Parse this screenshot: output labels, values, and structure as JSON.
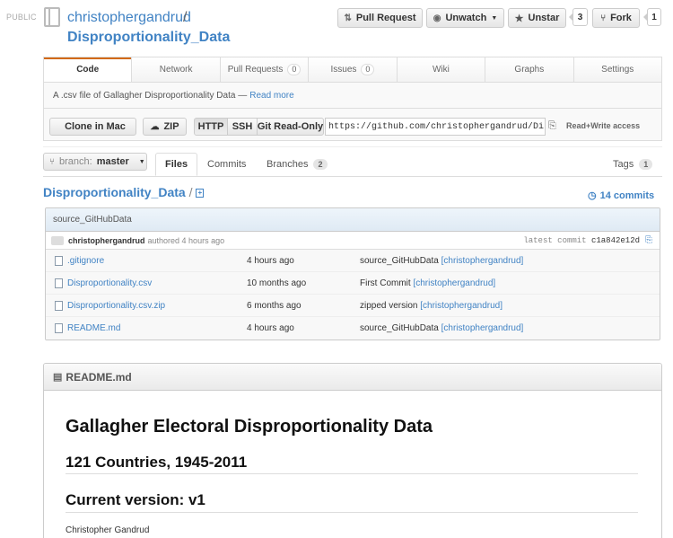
{
  "header": {
    "visibility": "PUBLIC",
    "owner": "christophergandrud",
    "separator": "/",
    "repo": "Disproportionality_Data",
    "buttons": {
      "pull_request": "Pull Request",
      "unwatch": "Unwatch",
      "unstar": "Unstar",
      "star_count": "3",
      "fork": "Fork",
      "fork_count": "1"
    }
  },
  "tabs": [
    {
      "label": "Code",
      "count": ""
    },
    {
      "label": "Network",
      "count": ""
    },
    {
      "label": "Pull Requests",
      "count": "0"
    },
    {
      "label": "Issues",
      "count": "0"
    },
    {
      "label": "Wiki",
      "count": ""
    },
    {
      "label": "Graphs",
      "count": ""
    },
    {
      "label": "Settings",
      "count": ""
    }
  ],
  "description": {
    "text": "A .csv file of Gallagher Disproportionality Data —",
    "link": "Read more"
  },
  "clone": {
    "clone_in_mac": "Clone in Mac",
    "zip": "ZIP",
    "http": "HTTP",
    "ssh": "SSH",
    "git_readonly": "Git Read-Only",
    "url": "https://github.com/christophergandrud/Di",
    "access": "Read+Write access"
  },
  "subnav": {
    "branch_prefix": "branch:",
    "branch": "master",
    "files": "Files",
    "commits": "Commits",
    "branches": "Branches",
    "branches_count": "2",
    "tags": "Tags",
    "tags_count": "1"
  },
  "breadcrumb": {
    "repo": "Disproportionality_Data",
    "sep": "/",
    "commits": "14 commits"
  },
  "latest": {
    "message": "source_GitHubData",
    "author": "christophergandrud",
    "authored": "authored 4 hours ago",
    "label": "latest commit",
    "sha": "c1a842e12d"
  },
  "files": [
    {
      "name": ".gitignore",
      "age": "4 hours ago",
      "message": "source_GitHubData",
      "author": "[christophergandrud]"
    },
    {
      "name": "Disproportionality.csv",
      "age": "10 months ago",
      "message": "First Commit",
      "author": "[christophergandrud]"
    },
    {
      "name": "Disproportionality.csv.zip",
      "age": "6 months ago",
      "message": "zipped version",
      "author": "[christophergandrud]"
    },
    {
      "name": "README.md",
      "age": "4 hours ago",
      "message": "source_GitHubData",
      "author": "[christophergandrud]"
    }
  ],
  "readme": {
    "filename": "README.md",
    "h1": "Gallagher Electoral Disproportionality Data",
    "h2": "121 Countries, 1945-2011",
    "h3": "Current version: v1",
    "author": "Christopher Gandrud"
  },
  "colors": {
    "link": "#4183c4",
    "active_tab": "#d26911"
  }
}
